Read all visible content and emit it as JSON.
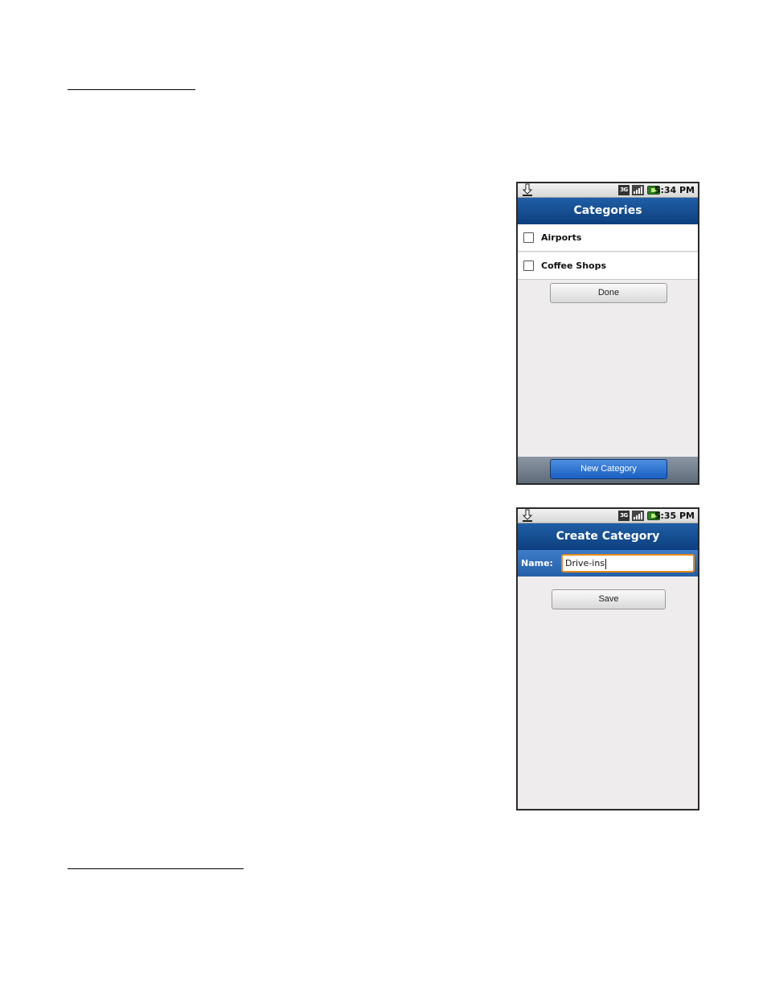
{
  "screen_categories": {
    "status_time": "5:34 PM",
    "title": "Categories",
    "items": [
      {
        "label": "Airports",
        "checked": false
      },
      {
        "label": "Coffee Shops",
        "checked": false
      }
    ],
    "done_label": "Done",
    "new_category_label": "New Category"
  },
  "screen_create": {
    "status_time": "5:35 PM",
    "title": "Create Category",
    "name_label": "Name:",
    "name_value": "Drive-ins",
    "save_label": "Save"
  },
  "icons": {
    "download": "download-icon",
    "network_3g": "3g-icon",
    "signal": "signal-icon",
    "battery": "battery-icon"
  },
  "colors": {
    "titlebar": "#0d3f7e",
    "primary_button": "#1a5fc2",
    "input_focus": "#e88a18",
    "battery": "#2e7d1f"
  }
}
